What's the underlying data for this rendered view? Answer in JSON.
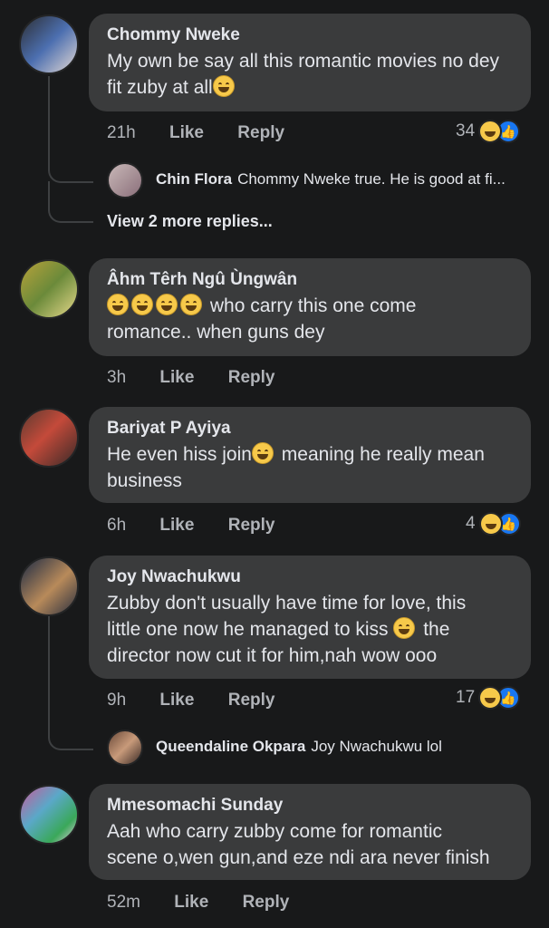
{
  "comments": [
    {
      "name": "Chommy Nweke",
      "text": "My own be say all this romantic movies no dey fit zuby at all",
      "time": "21h",
      "like": "Like",
      "reply": "Reply",
      "reactions": "34",
      "replies": [
        {
          "name": "Chin Flora",
          "text": "Chommy Nweke true. He is good at fi..."
        }
      ],
      "view_more": "View 2 more replies..."
    },
    {
      "name": "Âhm Têrh Ngû Ùngwân",
      "text_line1": "who carry this one come",
      "text_line2": "romance.. when guns dey",
      "time": "3h",
      "like": "Like",
      "reply": "Reply"
    },
    {
      "name": "Bariyat P Ayiya",
      "text_part1": "He even hiss join",
      "text_part2": "meaning he really mean",
      "text_line2": "business",
      "time": "6h",
      "like": "Like",
      "reply": "Reply",
      "reactions": "4"
    },
    {
      "name": "Joy Nwachukwu",
      "text_line1": "Zubby don't usually have time for love, this",
      "text_line2a": "little one now he managed to kiss",
      "text_line2b": "the",
      "text_line3": "director now cut it for him,nah wow ooo",
      "time": "9h",
      "like": "Like",
      "reply": "Reply",
      "reactions": "17",
      "replies": [
        {
          "name": "Queendaline Okpara",
          "text": "Joy Nwachukwu lol"
        }
      ]
    },
    {
      "name": "Mmesomachi Sunday",
      "text_line1": "Aah who carry zubby come for romantic",
      "text_line2": "scene o,wen gun,and eze ndi ara never finish",
      "time": "52m",
      "like": "Like",
      "reply": "Reply"
    }
  ],
  "icons": {
    "haha": "laughing-emoji-icon",
    "like": "thumbs-up-icon"
  },
  "colors": {
    "background": "#18191a",
    "bubble": "#3a3b3c",
    "text": "#e4e6eb",
    "meta": "#b0b3b8",
    "like_blue": "#1877f2"
  }
}
